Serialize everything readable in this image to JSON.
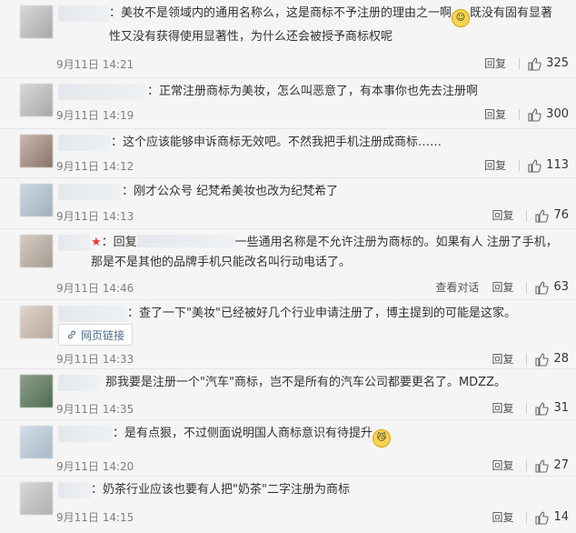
{
  "comments": [
    {
      "text": "：美妆不是领域内的通用名称么，这是商标不予注册的理由之一啊",
      "text2": "既没有固有显著性又没有获得使用显著性，为什么还会被授予商标权呢",
      "time": "9月11日 14:21",
      "reply": "回复",
      "likes": "325"
    },
    {
      "text": "：正常注册商标为美妆，怎么叫恶意了，有本事你也先去注册啊",
      "time": "9月11日 14:19",
      "reply": "回复",
      "likes": "300"
    },
    {
      "text": "：这个应该能够申诉商标无效吧。不然我把手机注册成商标……",
      "time": "9月11日 14:12",
      "reply": "回复",
      "likes": "113"
    },
    {
      "text": "：刚才公众号 纪梵希美妆也改为纪梵希了",
      "time": "9月11日 14:13",
      "reply": "回复",
      "likes": "76"
    },
    {
      "text_prefix": "：回复",
      "text": "一些通用名称是不允许注册为商标的。如果有人 注册了手机，那是不是其他的品牌手机只能改名叫行动电话了。",
      "time": "9月11日 14:46",
      "view_thread": "查看对话",
      "reply": "回复",
      "likes": "63"
    },
    {
      "text": "：查了一下\"美妆\"已经被好几个行业申请注册了，博主提到的可能是这家。",
      "link_label": "网页链接",
      "time": "9月11日 14:33",
      "reply": "回复",
      "likes": "28"
    },
    {
      "text": "那我要是注册一个\"汽车\"商标，岂不是所有的汽车公司都要更名了。MDZZ。",
      "time": "9月11日 14:35",
      "reply": "回复",
      "likes": "31"
    },
    {
      "text": "：是有点狠，不过侧面说明国人商标意识有待提升",
      "time": "9月11日 14:20",
      "reply": "回复",
      "likes": "27"
    },
    {
      "text": "：奶茶行业应该也要有人把\"奶茶\"二字注册为商标",
      "time": "9月11日 14:15",
      "reply": "回复",
      "likes": "14"
    }
  ],
  "icons": {
    "like": "thumbs-up-icon",
    "link": "link-icon",
    "star": "star-icon",
    "emoji": "emoji-icon"
  },
  "colors": {
    "background": "#f5f5f5",
    "highlight": "#eb7350",
    "star": "#e33333"
  }
}
